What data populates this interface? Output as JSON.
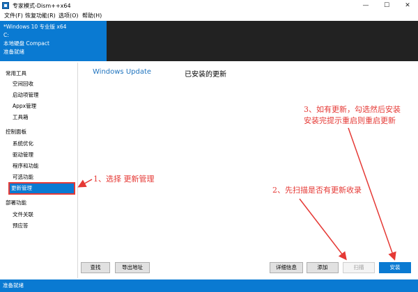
{
  "window": {
    "title": "专家模式-Dism++x64",
    "controls": {
      "minimize": "—",
      "maximize": "☐",
      "close": "✕"
    }
  },
  "menu": [
    {
      "label": "文件(F)"
    },
    {
      "label": "恢复功能(R)"
    },
    {
      "label": "选项(O)"
    },
    {
      "label": "帮助(H)"
    }
  ],
  "info": {
    "os": "*Windows 10 专业版 x64",
    "drive": "C:",
    "disk": "本地硬盘 Compact",
    "state": "准备就绪"
  },
  "sidebar": {
    "sections": [
      {
        "title": "常用工具",
        "items": [
          {
            "label": "空间回收"
          },
          {
            "label": "启动项管理"
          },
          {
            "label": "Appx管理"
          },
          {
            "label": "工具箱"
          }
        ]
      },
      {
        "title": "控制面板",
        "items": [
          {
            "label": "系统优化"
          },
          {
            "label": "驱动管理"
          },
          {
            "label": "程序和功能"
          },
          {
            "label": "可选功能"
          },
          {
            "label": "更新管理",
            "selected": true
          }
        ]
      },
      {
        "title": "部署功能",
        "items": [
          {
            "label": "文件关联"
          },
          {
            "label": "预应答"
          }
        ]
      }
    ]
  },
  "main": {
    "tabs": [
      {
        "label": "Windows Update",
        "active": true
      },
      {
        "label": "已安装的更新",
        "active": false
      }
    ]
  },
  "buttons": {
    "find": "查找",
    "export": "导出地址",
    "details": "详细信息",
    "add": "添加",
    "scan": "扫描",
    "install": "安装"
  },
  "status": "准备就绪",
  "annotations": {
    "step1": "1、选择 更新管理",
    "step2": "2、先扫描是否有更新收录",
    "step3_line1": "3、如有更新，勾选然后安装",
    "step3_line2": "安装完提示重启则重启更新"
  },
  "colors": {
    "accent": "#0a7ad2",
    "annotation": "#e53935",
    "dark_panel": "#222222"
  }
}
